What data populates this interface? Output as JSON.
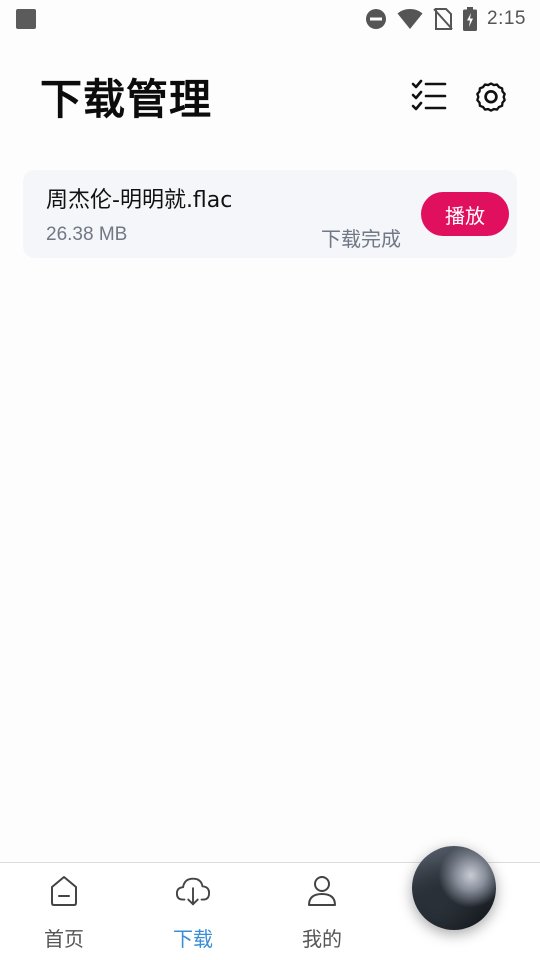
{
  "status_bar": {
    "time": "2:15",
    "icons": [
      "notification-square-icon",
      "do-not-disturb-icon",
      "wifi-icon",
      "no-sim-icon",
      "battery-charging-icon"
    ]
  },
  "header": {
    "title": "下载管理",
    "actions": [
      "checklist-icon",
      "gear-icon"
    ]
  },
  "downloads": [
    {
      "name": "周杰伦-明明就.flac",
      "size": "26.38 MB",
      "status": "下载完成",
      "action_label": "播放"
    }
  ],
  "bottom_nav": {
    "items": [
      {
        "label": "首页",
        "icon": "home-icon",
        "active": false
      },
      {
        "label": "下载",
        "icon": "cloud-download-icon",
        "active": true
      },
      {
        "label": "我的",
        "icon": "user-icon",
        "active": false
      }
    ]
  },
  "colors": {
    "accent": "#e0105e",
    "active_nav": "#3a8ed8",
    "card_bg": "#f5f6fa",
    "muted_text": "#707785"
  }
}
